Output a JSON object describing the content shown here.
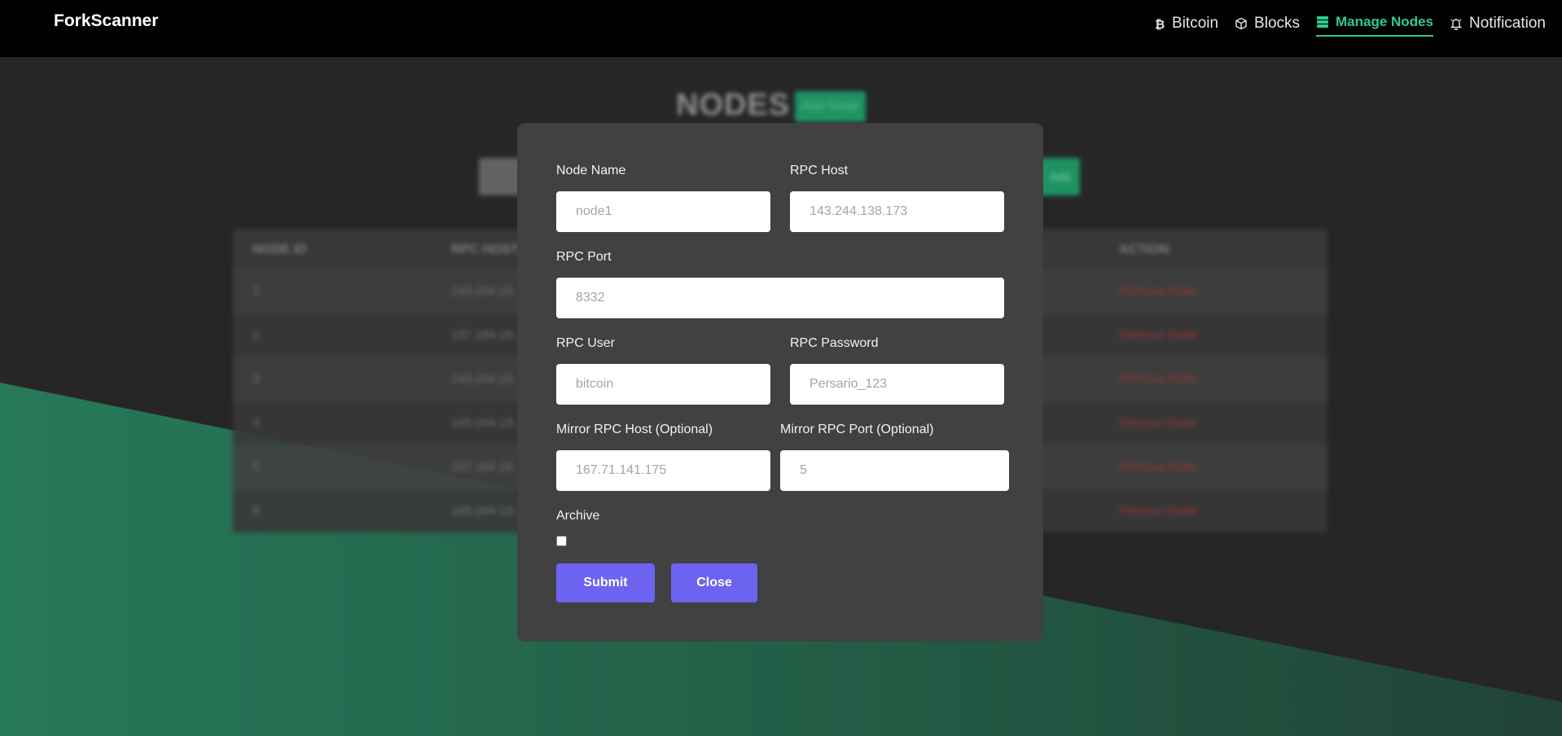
{
  "navbar": {
    "brand": "ForkScanner",
    "items": [
      {
        "label": "Bitcoin",
        "icon": "bitcoin-icon"
      },
      {
        "label": "Blocks",
        "icon": "cube-icon"
      },
      {
        "label": "Manage Nodes",
        "icon": "server-icon",
        "active": true
      },
      {
        "label": "Notification",
        "icon": "bell-icon"
      }
    ]
  },
  "background_page": {
    "title": "NODES",
    "add_button": "Add Node",
    "filter_button": "Add",
    "table": {
      "headers": [
        "NODE ID",
        "RPC HOST",
        "ACTION"
      ],
      "rows": [
        {
          "id": "1",
          "host": "143.244.13…",
          "action": "Remove Node"
        },
        {
          "id": "2",
          "host": "137.184.18…",
          "action": "Remove Node"
        },
        {
          "id": "3",
          "host": "143.244.13…",
          "action": "Remove Node"
        },
        {
          "id": "4",
          "host": "143.244.13…",
          "action": "Remove Node"
        },
        {
          "id": "5",
          "host": "137.184.18…",
          "action": "Remove Node"
        },
        {
          "id": "6",
          "host": "143.244.13…",
          "action": "Remove Node"
        }
      ]
    }
  },
  "modal": {
    "node_name": {
      "label": "Node Name",
      "placeholder": "node1"
    },
    "rpc_host": {
      "label": "RPC Host",
      "placeholder": "143.244.138.173"
    },
    "rpc_port": {
      "label": "RPC Port",
      "placeholder": "8332"
    },
    "rpc_user": {
      "label": "RPC User",
      "placeholder": "bitcoin"
    },
    "rpc_password": {
      "label": "RPC Password",
      "placeholder": "Persario_123"
    },
    "mirror_host": {
      "label": "Mirror RPC Host (Optional)",
      "placeholder": "167.71.141.175"
    },
    "mirror_port": {
      "label": "Mirror RPC Port (Optional)",
      "placeholder": "5"
    },
    "archive": {
      "label": "Archive",
      "checked": false
    },
    "submit_label": "Submit",
    "close_label": "Close"
  },
  "colors": {
    "accent_green": "#2ecc8f",
    "button_purple": "#6c63f0",
    "modal_bg": "#414141"
  }
}
